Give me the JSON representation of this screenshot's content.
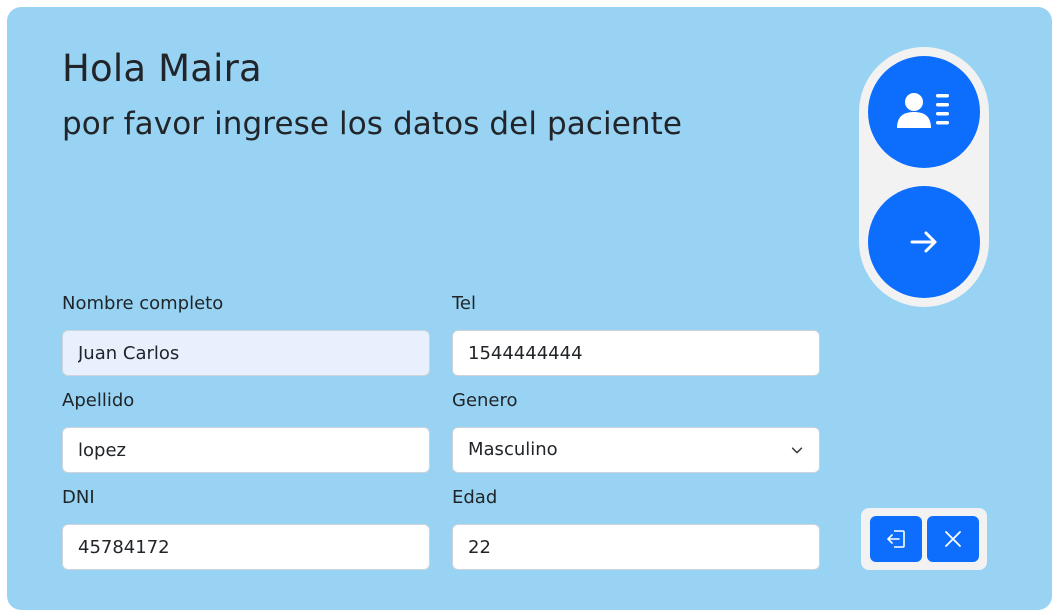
{
  "header": {
    "greeting": "Hola Maira",
    "subtitle": "por favor ingrese los datos del paciente"
  },
  "form": {
    "nombre": {
      "label": "Nombre completo",
      "value": "Juan Carlos"
    },
    "tel": {
      "label": "Tel",
      "value": "1544444444"
    },
    "apellido": {
      "label": "Apellido",
      "value": "lopez"
    },
    "genero": {
      "label": "Genero",
      "selected": "Masculino"
    },
    "dni": {
      "label": "DNI",
      "value": "45784172"
    },
    "edad": {
      "label": "Edad",
      "value": "22"
    }
  },
  "actions": {
    "patient_card_icon": "patient-card-icon",
    "next_icon": "arrow-right-icon",
    "logout_icon": "logout-icon",
    "close_icon": "close-icon"
  },
  "colors": {
    "background": "#98d3f3",
    "primary": "#0d6efd",
    "panel": "#f2f2f2",
    "autofill": "#e8f0fe"
  }
}
